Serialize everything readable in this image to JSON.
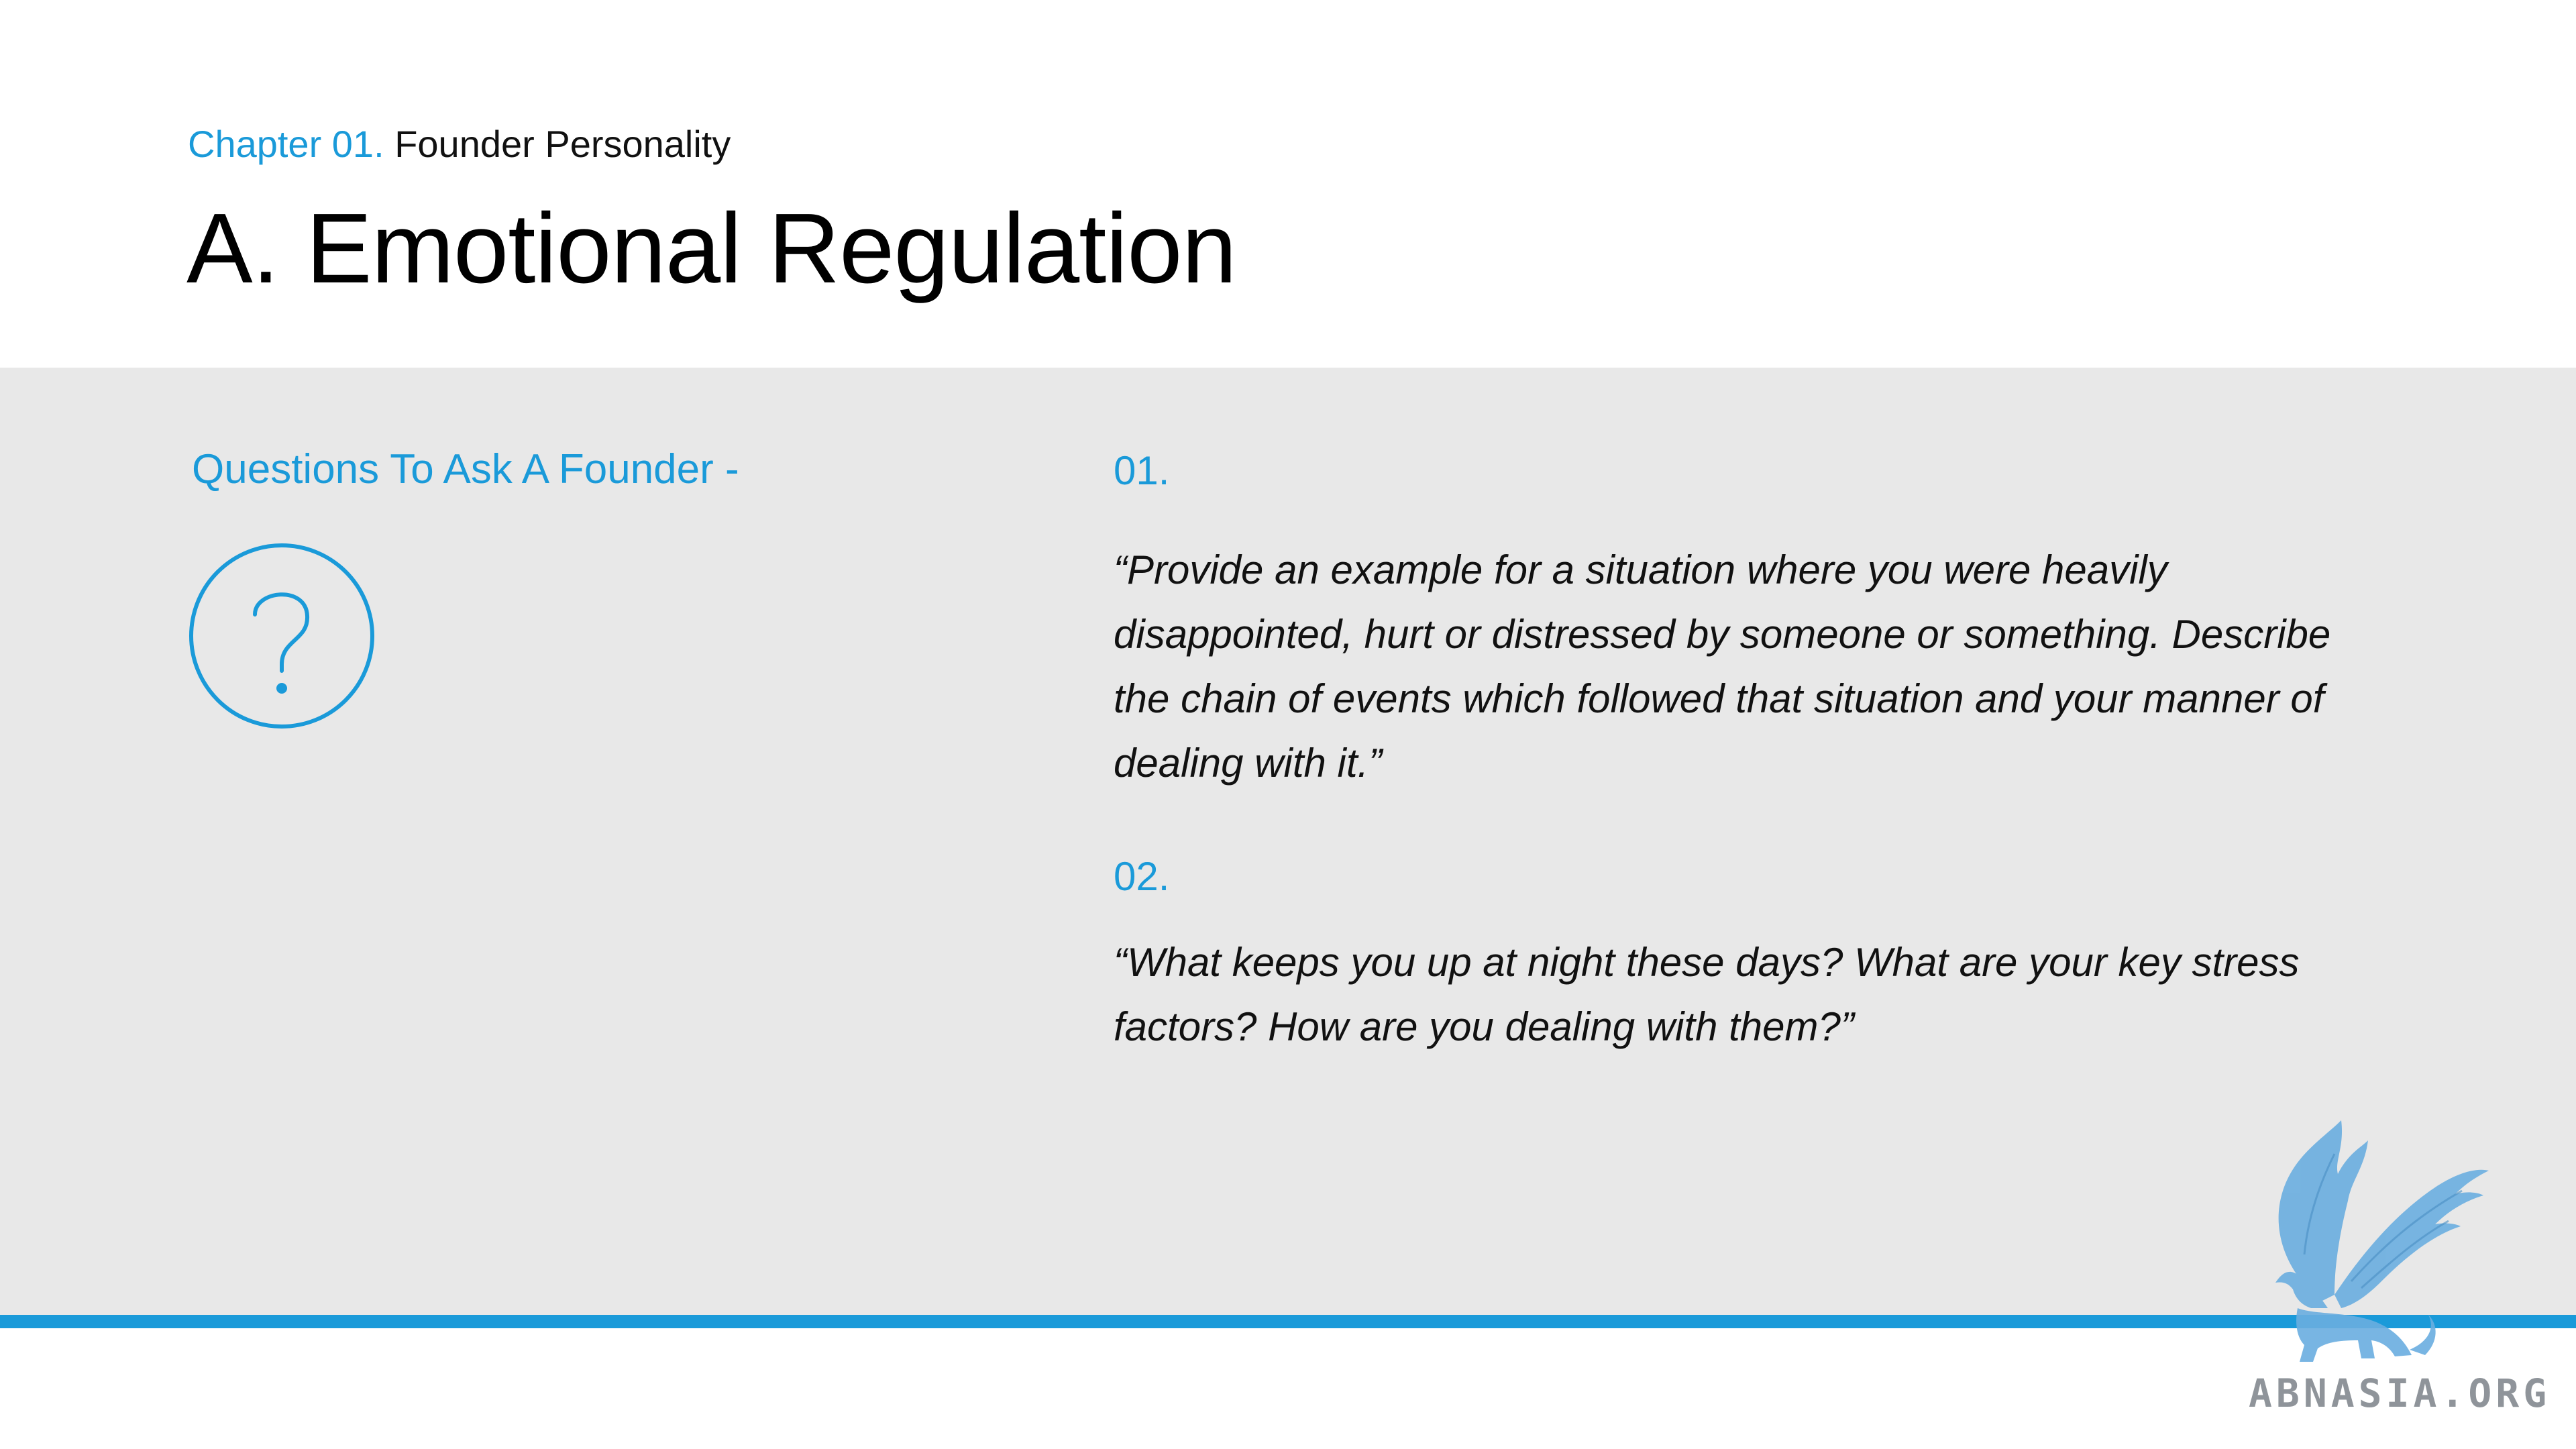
{
  "header": {
    "chapter_label": "Chapter 01.",
    "chapter_name": "Founder Personality",
    "title": "A. Emotional Regulation"
  },
  "sidebar": {
    "heading": "Questions To Ask A Founder -",
    "icon": "question-mark-circle-icon"
  },
  "questions": [
    {
      "number": "01.",
      "text": "“Provide an example for a situation where you were heavily disappointed, hurt or distressed by someone or something. Describe the chain of events which followed that situation and your manner of dealing with it.”"
    },
    {
      "number": "02.",
      "text": "“What keeps you up at night these days? What are your key stress factors? How are you dealing with them?”"
    }
  ],
  "watermark": {
    "icon": "griffin-logo-icon",
    "text": "ABNASIA.ORG"
  },
  "colors": {
    "accent": "#1a9ad9",
    "panel": "#e8e8e8",
    "watermark": "#6aaee0"
  }
}
